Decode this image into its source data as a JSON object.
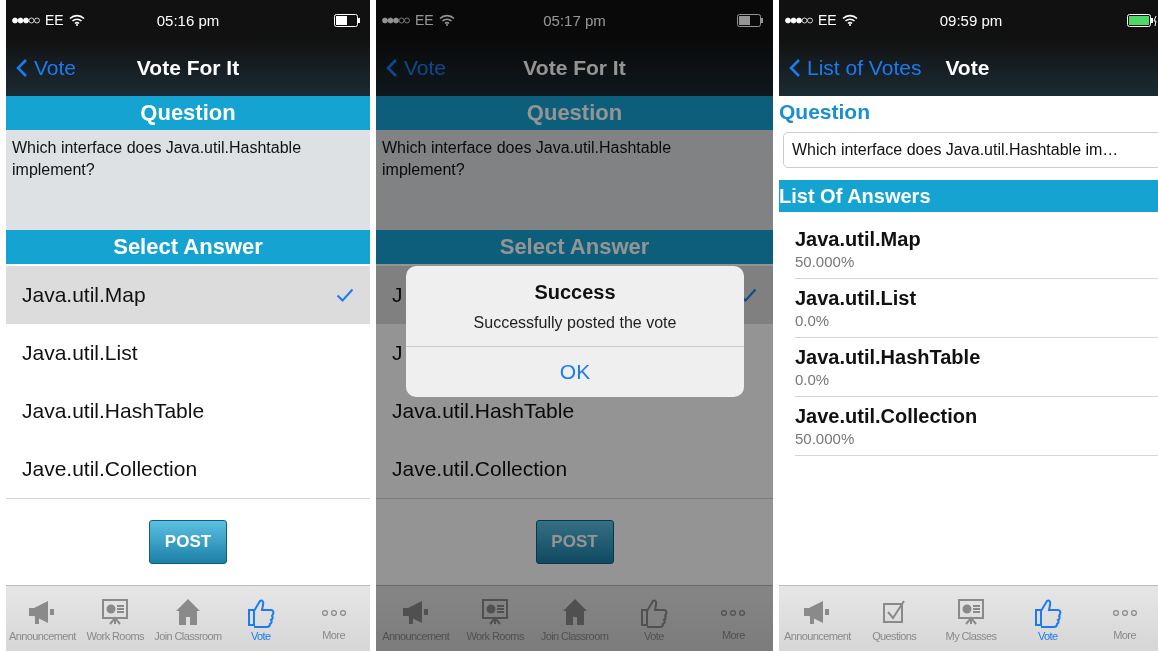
{
  "screens": [
    {
      "kind": "vote_form",
      "status": {
        "carrier": "EE",
        "time": "05:16 pm",
        "kind": "half"
      },
      "nav": {
        "back": "Vote",
        "title": "Vote For It"
      },
      "dimmed": false,
      "question_heading": "Question",
      "question": "Which interface does Java.util.Hashtable implement?",
      "answers_heading": "Select Answer",
      "answers": [
        {
          "text": "Java.util.Map",
          "selected": true
        },
        {
          "text": "Java.util.List",
          "selected": false
        },
        {
          "text": "Java.util.HashTable",
          "selected": false
        },
        {
          "text": "Jave.util.Collection",
          "selected": false
        }
      ],
      "post_button": "POST",
      "tabs": [
        {
          "kind": "megaphone",
          "label": "Announcement",
          "selected": false
        },
        {
          "kind": "board",
          "label": "Work Rooms",
          "selected": false
        },
        {
          "kind": "house",
          "label": "Join Classroom",
          "selected": false
        },
        {
          "kind": "thumb",
          "label": "Vote",
          "selected": true
        },
        {
          "kind": "dots",
          "label": "More",
          "selected": false
        }
      ]
    },
    {
      "kind": "vote_form",
      "status": {
        "carrier": "EE",
        "time": "05:17 pm",
        "kind": "half"
      },
      "nav": {
        "back": "Vote",
        "title": "Vote For It"
      },
      "dimmed": true,
      "question_heading": "Question",
      "question": "Which interface does Java.util.Hashtable implement?",
      "answers_heading": "Select Answer",
      "answers": [
        {
          "text": "J",
          "selected": true
        },
        {
          "text": "J",
          "selected": false
        },
        {
          "text": "Java.util.HashTable",
          "selected": false
        },
        {
          "text": "Jave.util.Collection",
          "selected": false
        }
      ],
      "post_button": "POST",
      "alert": {
        "title": "Success",
        "message": "Successfully posted the vote",
        "button": "OK"
      },
      "tabs": [
        {
          "kind": "megaphone",
          "label": "Announcement",
          "selected": false
        },
        {
          "kind": "board",
          "label": "Work Rooms",
          "selected": false
        },
        {
          "kind": "house",
          "label": "Join Classroom",
          "selected": false
        },
        {
          "kind": "thumb",
          "label": "Vote",
          "selected": false
        },
        {
          "kind": "dots",
          "label": "More",
          "selected": false
        }
      ]
    },
    {
      "kind": "results",
      "status": {
        "carrier": "EE",
        "time": "09:59 pm",
        "kind": "charging"
      },
      "nav": {
        "back": "List of Votes",
        "title": "Vote"
      },
      "dimmed": false,
      "question_heading": "Question",
      "question": "Which interface does Java.util.Hashtable im…",
      "answers_heading": "List Of Answers",
      "results": [
        {
          "text": "Java.util.Map",
          "percent": "50.000%"
        },
        {
          "text": "Java.util.List",
          "percent": "0.0%"
        },
        {
          "text": "Java.util.HashTable",
          "percent": "0.0%"
        },
        {
          "text": "Jave.util.Collection",
          "percent": "50.000%"
        }
      ],
      "tabs": [
        {
          "kind": "megaphone",
          "label": "Announcement",
          "selected": false
        },
        {
          "kind": "checkbox",
          "label": "Questions",
          "selected": false
        },
        {
          "kind": "board",
          "label": "My Classes",
          "selected": false
        },
        {
          "kind": "thumb",
          "label": "Vote",
          "selected": true
        },
        {
          "kind": "dots",
          "label": "More",
          "selected": false
        }
      ]
    }
  ]
}
